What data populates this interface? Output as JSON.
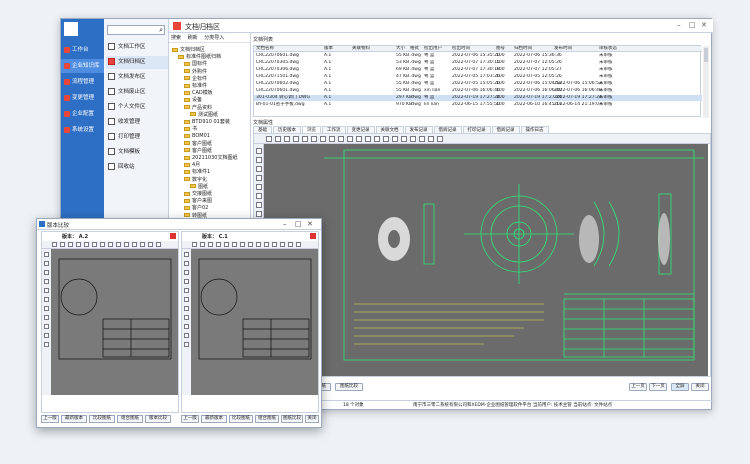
{
  "nav": {
    "items": [
      {
        "label": "工作台"
      },
      {
        "label": "企业知识库"
      },
      {
        "label": "流程管理"
      },
      {
        "label": "变更管理"
      },
      {
        "label": "企业配置"
      },
      {
        "label": "系统设置"
      }
    ]
  },
  "sidebar": {
    "search_placeholder": "",
    "items": [
      {
        "label": "文档工作区"
      },
      {
        "label": "文档归档区"
      },
      {
        "label": "文档发布区"
      },
      {
        "label": "文档废止区"
      },
      {
        "label": "个人文件区"
      },
      {
        "label": "收发管理"
      },
      {
        "label": "打印管理"
      },
      {
        "label": "文档模板"
      },
      {
        "label": "回收站"
      }
    ]
  },
  "window": {
    "title": "文档归档区"
  },
  "tree": {
    "toolbar": [
      "搜索",
      "刷新",
      "分类导入"
    ],
    "nodes": [
      {
        "label": "文档归档区",
        "depth": 0
      },
      {
        "label": "标准件图纸归档",
        "depth": 1
      },
      {
        "label": "国标件",
        "depth": 2
      },
      {
        "label": "外购件",
        "depth": 2
      },
      {
        "label": "企标件",
        "depth": 2
      },
      {
        "label": "标准件",
        "depth": 2
      },
      {
        "label": "CAD模板",
        "depth": 2
      },
      {
        "label": "设备",
        "depth": 2
      },
      {
        "label": "产品资料",
        "depth": 2
      },
      {
        "label": "测试图纸",
        "depth": 3
      },
      {
        "label": "BTD910 01套装",
        "depth": 2
      },
      {
        "label": "书",
        "depth": 2
      },
      {
        "label": "BOM01",
        "depth": 2
      },
      {
        "label": "客户图纸",
        "depth": 2
      },
      {
        "label": "客户图纸",
        "depth": 2
      },
      {
        "label": "20211030文档图纸",
        "depth": 2
      },
      {
        "label": "4月",
        "depth": 2
      },
      {
        "label": "标准件1",
        "depth": 2
      },
      {
        "label": "数字化",
        "depth": 2
      },
      {
        "label": "图纸",
        "depth": 3
      },
      {
        "label": "交接图纸",
        "depth": 2
      },
      {
        "label": "客户来图",
        "depth": 2
      },
      {
        "label": "客户02",
        "depth": 2
      },
      {
        "label": "转图纸",
        "depth": 2
      },
      {
        "label": "01图纸",
        "depth": 2
      },
      {
        "label": "客户02",
        "depth": 2
      }
    ]
  },
  "file_list": {
    "label": "文档列表",
    "columns": [
      "文档名称",
      "版本",
      "关联物料",
      "大小",
      "格式",
      "检出用户",
      "检出时间",
      "图号",
      "归档时间",
      "发布时间",
      "审核状态"
    ],
    "rows": [
      [
        "CRC22070601.dwg",
        "A.1",
        "",
        "55 KB",
        ".dwg",
        "粤 蓝",
        "2022-07-06 15:35:20",
        "100",
        "2022-07-06 15:36:36",
        "",
        "未审核"
      ],
      [
        "CRC22070305.dwg",
        "A.1",
        "",
        "53 KB",
        ".dwg",
        "粤 蓝",
        "2022-07-07 17:30:15",
        "100",
        "2022-07-07 12:05:26",
        "",
        "未审核"
      ],
      [
        "CRC22070306.dwg",
        "A.1",
        "",
        "69 KB",
        ".dwg",
        "粤 蓝",
        "2022-07-07 17:30:19",
        "100",
        "2022-07-07 12:05:27",
        "",
        "未审核"
      ],
      [
        "CRC22071501.dwg",
        "A.1",
        "",
        "47 KB",
        ".dwg",
        "粤 蓝",
        "2022-07-05 17:03:26",
        "100",
        "2022-07-05 12:05:26",
        "",
        "未审核"
      ],
      [
        "CRC22070602.dwg",
        "A.1",
        "",
        "55 KB",
        ".dwg",
        "粤 蓝",
        "2022-07-05 15:05:26",
        "100",
        "2022-07-06 15:04:52",
        "2022-07-06 15:06:52",
        "未审核"
      ],
      [
        "CRC22070601.dwg",
        "A.1",
        "",
        "55 KB",
        ".dwg",
        "xin lian",
        "2022-07-06 16:06:46",
        "100",
        "2022-07-06 16:06:40",
        "2022-07-06 16:06:40",
        "未审核"
      ],
      [
        "301-0304 转心调门 DWG",
        "A.1",
        "",
        "297 KB",
        ".dwg",
        "粤 蓝",
        "2022-07-19 17:27:24",
        "100",
        "2022-07-19 17:27:24",
        "2022-07-19 17:27:24",
        "未审核"
      ],
      [
        "BY-01-01密子手板.dwg",
        "A.1",
        "",
        "970 KB",
        ".dwg",
        "lin lian",
        "2022-06-15 17:55:50",
        "100",
        "2022-06-10 16:45:17",
        "2022-06-14 21:19:07",
        "未审核"
      ]
    ]
  },
  "props": {
    "label": "文档属性",
    "tabs": [
      "基础",
      "历史版本",
      "浏览",
      "工作流",
      "变更记录",
      "关联文档",
      "发布记录",
      "借阅记录",
      "打印记录",
      "借阅记录",
      "操作日志"
    ],
    "active_tab": 2
  },
  "bottom": {
    "left_buttons": [
      "比较",
      "组合图纸",
      "图纸比较"
    ],
    "right_buttons": [
      "上一页",
      "下一页",
      "全屏",
      "关闭"
    ]
  },
  "status": {
    "count": "18 个对象",
    "company": "南宁市三零二系统有限公司和XEDM-企业图纸管理软件平台  当前用户: 技术主管  当前站点: 文件站点"
  },
  "compare": {
    "title": "版本比较",
    "left_version": "版本： A.2",
    "right_version": "版本： C.1",
    "left_buttons": [
      "上一版",
      "最新版本",
      "比较图纸",
      "组合图纸",
      "版本比较"
    ],
    "right_buttons": [
      "上一版",
      "最新版本",
      "比较图纸",
      "组合图纸",
      "图纸比较",
      "关闭"
    ]
  },
  "colors": {
    "nav": "#2d6fc4",
    "accent": "#e8463a",
    "canvas": "#6b6b6b",
    "drawing": "#2ee87a"
  }
}
